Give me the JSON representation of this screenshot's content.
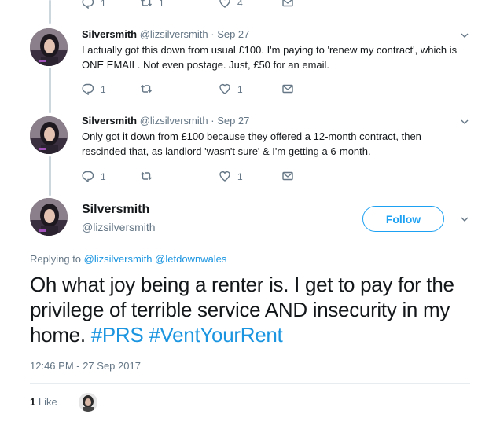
{
  "top_actions": {
    "reply_count": "1",
    "retweet_count": "1",
    "like_count": "4"
  },
  "tweets": [
    {
      "name": "Silversmith",
      "handle": "@lizsilversmith",
      "date": "Sep 27",
      "text": "I actually got this down from usual £100. I'm paying to 'renew my contract', which is ONE EMAIL. Not even postage. Just, £50 for an email.",
      "reply_count": "1",
      "retweet_count": "",
      "like_count": "1"
    },
    {
      "name": "Silversmith",
      "handle": "@lizsilversmith",
      "date": "Sep 27",
      "text": "Only got it down from £100 because they offered a 12-month contract, then rescinded that, as landlord 'wasn't sure' & I'm getting a 6-month.",
      "reply_count": "1",
      "retweet_count": "",
      "like_count": "1"
    }
  ],
  "main": {
    "name": "Silversmith",
    "handle": "@lizsilversmith",
    "follow_label": "Follow",
    "replying_prefix": "Replying to",
    "replying_to": [
      "@lizsilversmith",
      "@letdownwales"
    ],
    "text_plain": "Oh what joy being a renter is. I get to pay for the privilege of terrible service AND insecurity in my home.",
    "hashtags": [
      "#PRS",
      "#VentYourRent"
    ],
    "timestamp": "12:46 PM - 27 Sep 2017",
    "likes_count": "1",
    "likes_label": "Like"
  },
  "colors": {
    "accent": "#1da1f2",
    "link": "#1b95e0",
    "muted": "#657786",
    "thread_line": "#ccd6dd"
  }
}
